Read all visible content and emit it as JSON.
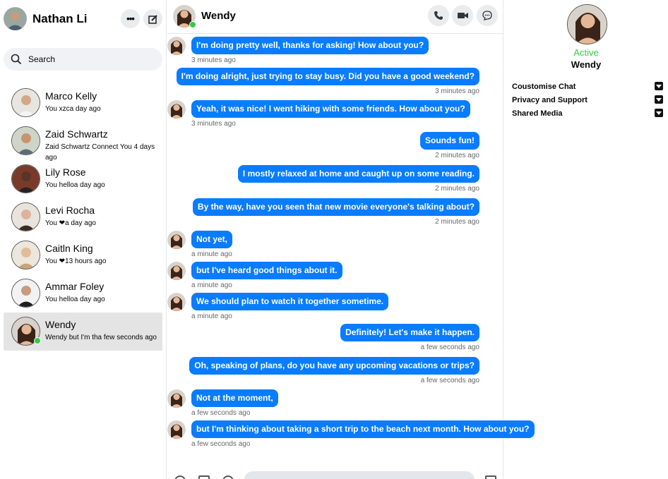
{
  "me": {
    "name": "Nathan Li"
  },
  "search": {
    "placeholder": "Search"
  },
  "conversations": [
    {
      "name": "Marco Kelly",
      "preview": "You xzca day ago"
    },
    {
      "name": "Zaid Schwartz",
      "preview": "Zaid Schwartz Connect You 4 days ago"
    },
    {
      "name": "Lily Rose",
      "preview": "You helloa day ago"
    },
    {
      "name": "Levi Rocha",
      "preview": "You ❤a day ago"
    },
    {
      "name": "Caitln King",
      "preview": "You ❤13 hours ago"
    },
    {
      "name": "Ammar Foley",
      "preview": "You helloa day ago"
    },
    {
      "name": "Wendy",
      "preview": "Wendy but I'm tha few seconds ago"
    }
  ],
  "chat": {
    "name": "Wendy",
    "messages": [
      {
        "from": "them",
        "text": "I'm doing pretty well, thanks for asking! How about you?",
        "time": "3 minutes ago"
      },
      {
        "from": "me",
        "text": "I'm doing alright, just trying to stay busy. Did you have a good weekend?",
        "time": "3 minutes ago"
      },
      {
        "from": "them",
        "text": "Yeah, it was nice! I went hiking with some friends. How about you?",
        "time": "3 minutes ago"
      },
      {
        "from": "me",
        "text": "Sounds fun!",
        "time": "2 minutes ago"
      },
      {
        "from": "me",
        "text": "I mostly relaxed at home and caught up on some reading.",
        "time": "2 minutes ago"
      },
      {
        "from": "me",
        "text": "By the way, have you seen that new movie everyone's talking about?",
        "time": "2 minutes ago"
      },
      {
        "from": "them",
        "text": "Not yet,",
        "time": "a minute ago"
      },
      {
        "from": "them",
        "text": "but I've heard good things about it.",
        "time": "a minute ago"
      },
      {
        "from": "them",
        "text": "We should plan to watch it together sometime.",
        "time": "a minute ago"
      },
      {
        "from": "me",
        "text": "Definitely! Let's make it happen.",
        "time": "a few seconds ago"
      },
      {
        "from": "me",
        "text": "Oh, speaking of plans, do you have any upcoming vacations or trips?",
        "time": "a few seconds ago"
      },
      {
        "from": "them",
        "text": "Not at the moment,",
        "time": "a few seconds ago"
      },
      {
        "from": "them",
        "text": "but I'm thinking about taking a short trip to the beach next month. How about you?",
        "time": "a few seconds ago"
      }
    ]
  },
  "info": {
    "status": "Active",
    "name": "Wendy",
    "options": [
      "Coustomise Chat",
      "Privacy and Support",
      "Shared Media"
    ]
  },
  "colors": {
    "accent": "#0a7cff",
    "online": "#31cc46",
    "active_row": "#e4e4e4"
  }
}
